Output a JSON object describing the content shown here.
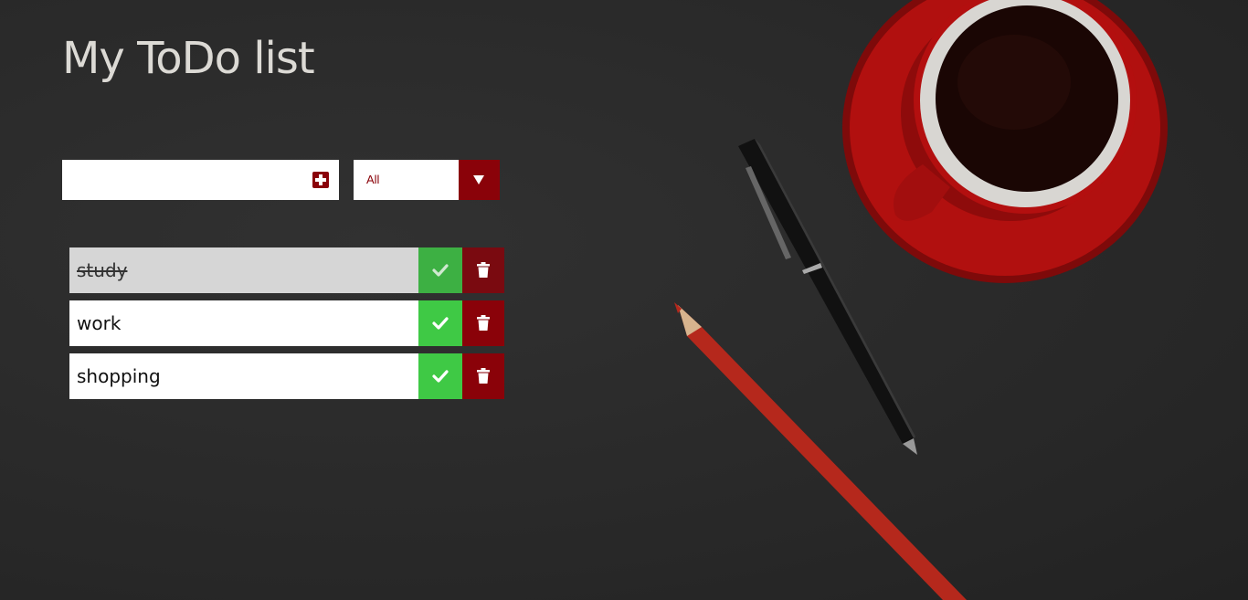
{
  "page": {
    "title": "My ToDo list"
  },
  "add_form": {
    "input_value": "",
    "add_icon": "plus-square-icon"
  },
  "filter": {
    "selected": "All",
    "arrow_icon": "caret-down-icon"
  },
  "todos": [
    {
      "text": "study",
      "completed": true
    },
    {
      "text": "work",
      "completed": false
    },
    {
      "text": "shopping",
      "completed": false
    }
  ],
  "icons": {
    "check": "check-icon",
    "trash": "trash-icon"
  },
  "colors": {
    "accent": "#8a0209",
    "complete_green": "#3fc945",
    "background": "#2b2b2b",
    "title": "#dcdad5"
  }
}
